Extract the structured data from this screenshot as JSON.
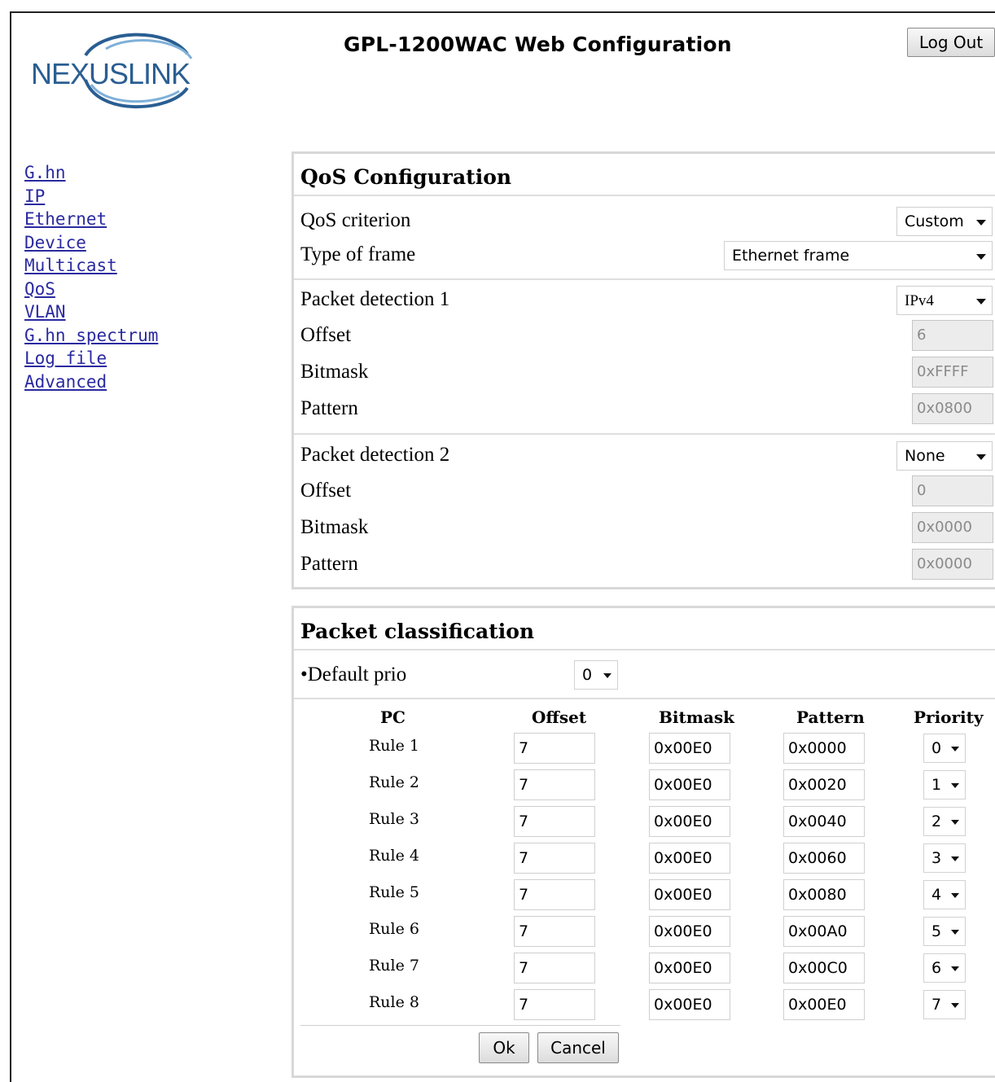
{
  "brand": {
    "logo_text": "NEXUSLINK"
  },
  "header": {
    "title": "GPL-1200WAC Web Configuration",
    "logout_label": "Log Out"
  },
  "nav": {
    "items": [
      {
        "label": "G.hn"
      },
      {
        "label": "IP"
      },
      {
        "label": "Ethernet"
      },
      {
        "label": "Device"
      },
      {
        "label": "Multicast"
      },
      {
        "label": "QoS"
      },
      {
        "label": "VLAN"
      },
      {
        "label": "G.hn spectrum"
      },
      {
        "label": "Log file"
      },
      {
        "label": "Advanced"
      }
    ]
  },
  "qos": {
    "heading": "QoS Configuration",
    "criterion": {
      "label": "QoS criterion",
      "value": "Custom"
    },
    "frame_type": {
      "label": "Type of frame",
      "value": "Ethernet frame"
    },
    "detection1": {
      "label": "Packet detection 1",
      "value": "IPv4",
      "offset_label": "Offset",
      "offset": "6",
      "bitmask_label": "Bitmask",
      "bitmask": "0xFFFF",
      "pattern_label": "Pattern",
      "pattern": "0x0800"
    },
    "detection2": {
      "label": "Packet detection 2",
      "value": "None",
      "offset_label": "Offset",
      "offset": "0",
      "bitmask_label": "Bitmask",
      "bitmask": "0x0000",
      "pattern_label": "Pattern",
      "pattern": "0x0000"
    }
  },
  "classification": {
    "heading": "Packet classification",
    "default_prio_label": "•Default prio",
    "default_prio": "0",
    "columns": {
      "pc": "PC",
      "offset": "Offset",
      "bitmask": "Bitmask",
      "pattern": "Pattern",
      "priority": "Priority"
    },
    "rules": [
      {
        "name": "Rule 1",
        "offset": "7",
        "bitmask": "0x00E0",
        "pattern": "0x0000",
        "priority": "0"
      },
      {
        "name": "Rule 2",
        "offset": "7",
        "bitmask": "0x00E0",
        "pattern": "0x0020",
        "priority": "1"
      },
      {
        "name": "Rule 3",
        "offset": "7",
        "bitmask": "0x00E0",
        "pattern": "0x0040",
        "priority": "2"
      },
      {
        "name": "Rule 4",
        "offset": "7",
        "bitmask": "0x00E0",
        "pattern": "0x0060",
        "priority": "3"
      },
      {
        "name": "Rule 5",
        "offset": "7",
        "bitmask": "0x00E0",
        "pattern": "0x0080",
        "priority": "4"
      },
      {
        "name": "Rule 6",
        "offset": "7",
        "bitmask": "0x00E0",
        "pattern": "0x00A0",
        "priority": "5"
      },
      {
        "name": "Rule 7",
        "offset": "7",
        "bitmask": "0x00E0",
        "pattern": "0x00C0",
        "priority": "6"
      },
      {
        "name": "Rule 8",
        "offset": "7",
        "bitmask": "0x00E0",
        "pattern": "0x00E0",
        "priority": "7"
      }
    ],
    "ok_label": "Ok",
    "cancel_label": "Cancel"
  }
}
